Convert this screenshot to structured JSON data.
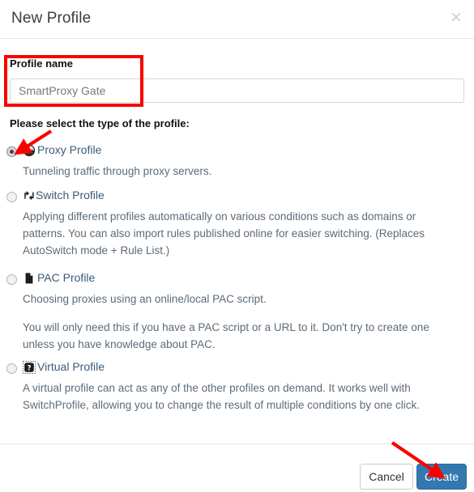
{
  "dialog": {
    "title": "New Profile",
    "close_icon": "close-icon",
    "close_label": "×"
  },
  "form": {
    "profile_name_label": "Profile name",
    "profile_name_value": "SmartProxy Gate",
    "profile_name_placeholder": "SmartProxy Gate",
    "section_prompt": "Please select the type of the profile:"
  },
  "profile_types": [
    {
      "id": "proxy",
      "label": "Proxy Profile",
      "icon": "globe-icon",
      "selected": true,
      "descriptions": [
        "Tunneling traffic through proxy servers."
      ]
    },
    {
      "id": "switch",
      "label": "Switch Profile",
      "icon": "exchange-arrows-icon",
      "selected": false,
      "descriptions": [
        "Applying different profiles automatically on various conditions such as domains or patterns. You can also import rules published online for easier switching. (Replaces AutoSwitch mode + Rule List.)"
      ]
    },
    {
      "id": "pac",
      "label": "PAC Profile",
      "icon": "document-icon",
      "selected": false,
      "descriptions": [
        "Choosing proxies using an online/local PAC script.",
        "You will only need this if you have a PAC script or a URL to it. Don't try to create one unless you have knowledge about PAC."
      ]
    },
    {
      "id": "virtual",
      "label": "Virtual Profile",
      "icon": "question-badge-icon",
      "selected": false,
      "descriptions": [
        "A virtual profile can act as any of the other profiles on demand. It works well with SwitchProfile, allowing you to change the result of multiple conditions by one click."
      ]
    }
  ],
  "footer": {
    "cancel_label": "Cancel",
    "create_label": "Create"
  },
  "colors": {
    "primary_button": "#3478ae",
    "annotation_red": "#fc0000",
    "link_text": "#3c5a78",
    "body_text": "#5d6b77"
  },
  "annotations": [
    {
      "type": "highlight-box",
      "target": "profile-name-field"
    },
    {
      "type": "arrow",
      "target": "proxy-profile-radio"
    },
    {
      "type": "arrow",
      "target": "create-button"
    }
  ]
}
